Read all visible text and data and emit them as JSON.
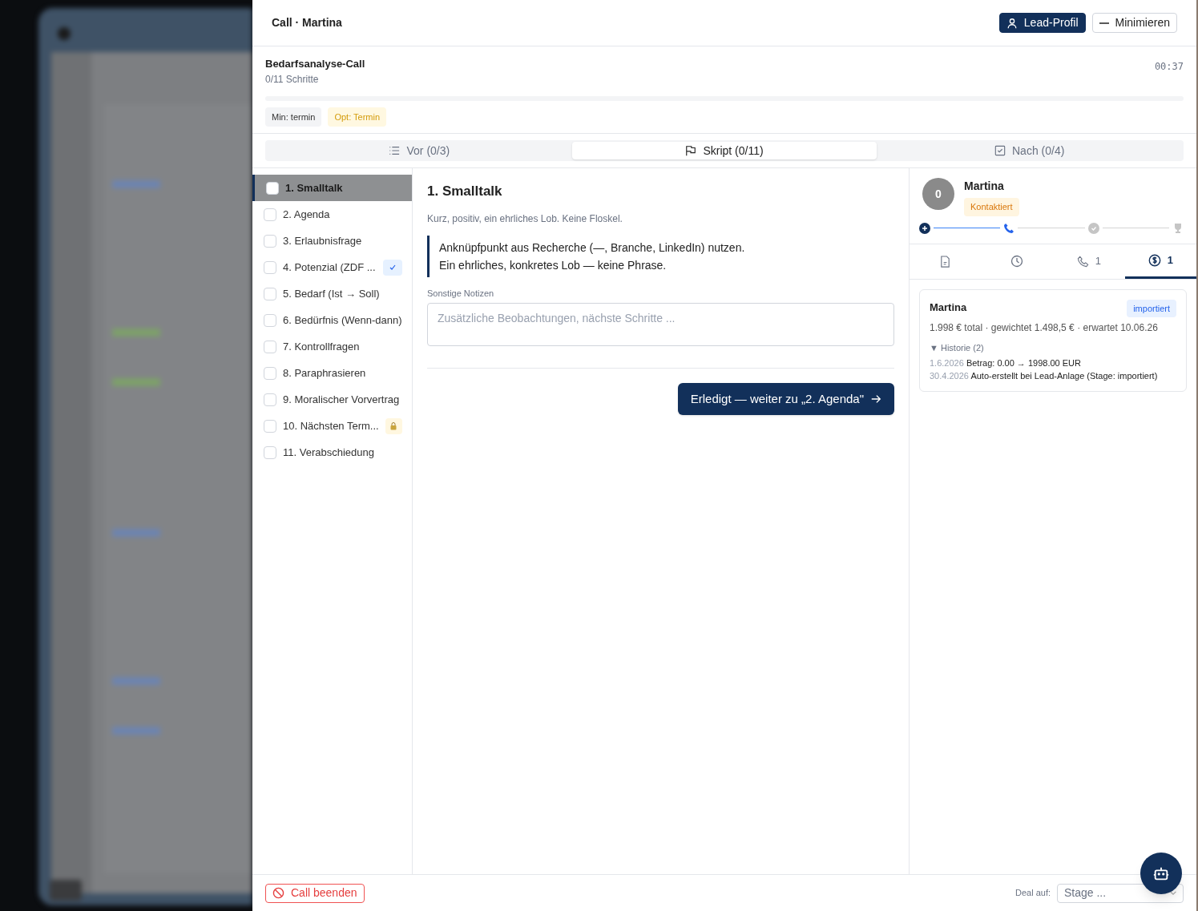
{
  "header": {
    "title": "Call · Martina",
    "buttons": [
      {
        "kind": "profile",
        "label": "Lead-Profil"
      },
      {
        "kind": "minimize",
        "label": "Minimieren"
      }
    ]
  },
  "script": {
    "name": "Bedarfsanalyse-Call",
    "progress_text": "0/11 Schritte",
    "timer": "00:37",
    "level": 0,
    "tags": [
      {
        "kind": "min",
        "label": "Min: termin"
      },
      {
        "kind": "opt",
        "label": "Opt: Termin"
      }
    ]
  },
  "tabs": [
    {
      "kind": "list",
      "label": "Vor (0/3)",
      "selected": false
    },
    {
      "kind": "flag",
      "label": "Skript (0/11)",
      "selected": true
    },
    {
      "kind": "check",
      "label": "Nach (0/4)",
      "selected": false
    }
  ],
  "steps": [
    {
      "label": "1. Smalltalk",
      "checked": false,
      "selected": true
    },
    {
      "label": "2. Agenda",
      "checked": false,
      "selected": false
    },
    {
      "label": "3. Erlaubnisfrage",
      "checked": false,
      "selected": false
    },
    {
      "label": "4. Potenzial (ZDF ...",
      "checked": false,
      "selected": false,
      "kind": "done"
    },
    {
      "label": "5. Bedarf (Ist → Soll)",
      "checked": false,
      "selected": false
    },
    {
      "label": "6. Bedürfnis (Wenn-dann)",
      "checked": false,
      "selected": false
    },
    {
      "label": "7. Kontrollfragen",
      "checked": false,
      "selected": false
    },
    {
      "label": "8. Paraphrasieren",
      "checked": false,
      "selected": false
    },
    {
      "label": "9. Moralischer Vorvertrag",
      "checked": false,
      "selected": false
    },
    {
      "label": "10. Nächsten Term...",
      "checked": false,
      "selected": false,
      "kind": "locked"
    },
    {
      "label": "11. Verabschiedung",
      "checked": false,
      "selected": false
    }
  ],
  "step_detail": {
    "title": "1. Smalltalk",
    "hint": "Kurz, positiv, ein ehrliches Lob. Keine Floskel.",
    "quote_lines": [
      "Anknüpfpunkt aus Recherche (—, Branche, LinkedIn) nutzen.",
      "Ein ehrliches, konkretes Lob — keine Phrase."
    ],
    "notes_label": "Sonstige Notizen",
    "notes_placeholder": "Zusätzliche Beobachtungen, nächste Schritte ...",
    "next_button": "Erledigt — weiter zu „2. Agenda\""
  },
  "lead": {
    "avatar": "0",
    "name": "Martina",
    "status": "Kontaktiert",
    "pipeline": [
      {
        "kind": "created",
        "reached": true,
        "current": false
      },
      {
        "kind": "call",
        "reached": true,
        "current": true
      },
      {
        "kind": "qualified",
        "reached": false,
        "current": false
      },
      {
        "kind": "won",
        "reached": false,
        "current": false
      }
    ]
  },
  "lead_tabs": [
    {
      "kind": "document",
      "selected": false
    },
    {
      "kind": "clock",
      "selected": false
    },
    {
      "kind": "phone",
      "count": "1",
      "selected": false
    },
    {
      "kind": "dollar",
      "count": "1",
      "selected": true
    }
  ],
  "deal": {
    "name": "Martina",
    "stage": "importiert",
    "summary": "1.998 € total · gewichtet 1.498,5 € · erwartet 10.06.26",
    "history_toggle": "▼ Historie (2)",
    "history": [
      {
        "date": "1.6.2026",
        "text": "Betrag: 0.00 → 1998.00 EUR"
      },
      {
        "date": "30.4.2026",
        "text": "Auto-erstellt bei Lead-Anlage (Stage: importiert)"
      }
    ]
  },
  "footer": {
    "end_button": "Call beenden",
    "deal_label": "Deal auf:",
    "stage_placeholder": "Stage ..."
  }
}
